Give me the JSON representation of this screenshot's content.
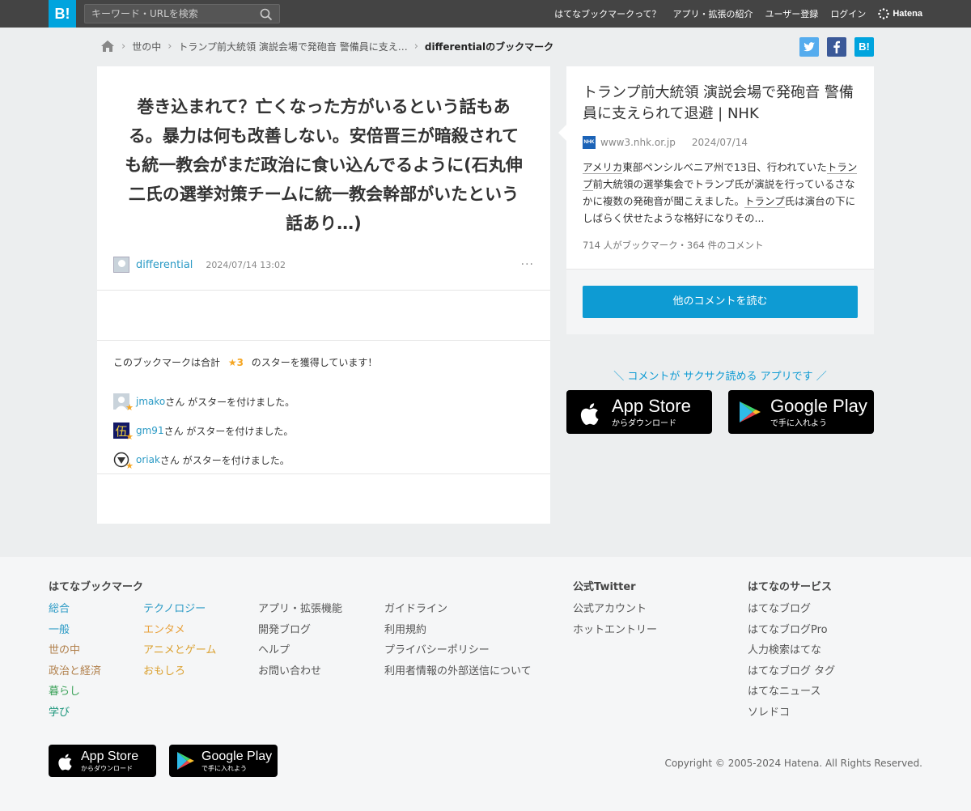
{
  "topbar": {
    "logo": "B!",
    "search_placeholder": "キーワード・URLを検索",
    "nav": [
      "はてなブックマークって？",
      "アプリ・拡張の紹介",
      "ユーザー登録",
      "ログイン"
    ],
    "brand": "Hatena"
  },
  "breadcrumb": {
    "items": [
      "世の中",
      "トランプ前大統領 演説会場で発砲音 警備員に支え…"
    ],
    "current": "differentialのブックマーク"
  },
  "share": {
    "twitter": "t",
    "facebook": "f",
    "hatebu": "B!"
  },
  "bookmark": {
    "comment": "巻き込まれて？亡くなった方がいるという話もある。暴力は何も改善しない。安倍晋三が暗殺されても統一教会がまだ政治に食い込んでるように(石丸伸二氏の選挙対策チームに統一教会幹部がいたという話あり…)",
    "user": "differential",
    "timestamp": "2024/07/14 13:02",
    "more": "···"
  },
  "stars": {
    "summary_prefix": "このブックマークは合計",
    "count": "★3",
    "summary_suffix": "のスターを獲得しています！",
    "suffix": "さん がスターを付けました。",
    "users": [
      "jmako",
      "gm91",
      "oriak"
    ]
  },
  "entry": {
    "title": "トランプ前大統領 演説会場で発砲音 警備員に支えられて退避 | NHK",
    "favicon": "NHK",
    "domain": "www3.nhk.or.jp",
    "date": "2024/07/14",
    "summary_parts": [
      "アメリカ",
      "東部ペンシルベニア州で13日、行われていた",
      "トランプ",
      "前大統領の選挙集会でトランプ氏が演説を行っているさなかに複数の発砲音が聞こえました。",
      "トランプ",
      "氏は演台の下にしばらく伏せたような格好になりその..."
    ],
    "counts": "714 人がブックマーク・364 件のコメント",
    "read_button": "他のコメントを読む"
  },
  "promo": {
    "text": "＼ コメントが サクサク読める アプリです ／",
    "appstore_main": "App Store",
    "appstore_sub": "からダウンロード",
    "gplay_main": "Google Play",
    "gplay_sub": "で手に入れよう"
  },
  "footer": {
    "col1_head": "はてなブックマーク",
    "col1": [
      "総合",
      "一般",
      "世の中",
      "政治と経済",
      "暮らし",
      "学び"
    ],
    "col2": [
      "テクノロジー",
      "エンタメ",
      "アニメとゲーム",
      "おもしろ"
    ],
    "col3": [
      "アプリ・拡張機能",
      "開発ブログ",
      "ヘルプ",
      "お問い合わせ"
    ],
    "col4": [
      "ガイドライン",
      "利用規約",
      "プライバシーポリシー",
      "利用者情報の外部送信について"
    ],
    "col5_head": "公式Twitter",
    "col5": [
      "公式アカウント",
      "ホットエントリー"
    ],
    "col6_head": "はてなのサービス",
    "col6": [
      "はてなブログ",
      "はてなブログPro",
      "人力検索はてな",
      "はてなブログ タグ",
      "はてなニュース",
      "ソレドコ"
    ],
    "copyright": "Copyright © 2005-2024 Hatena. All Rights Reserved."
  },
  "colors": {
    "accent": "#00a4de",
    "button": "#0e9bd3",
    "star": "#f5a623",
    "topbar": "#444444"
  }
}
